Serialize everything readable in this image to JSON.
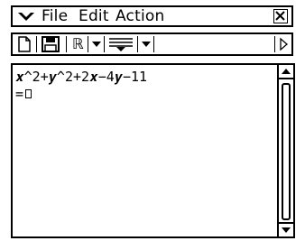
{
  "menubar": {
    "menu_icon": "chevron-down-icon",
    "items": [
      {
        "label": "File"
      },
      {
        "label": "Edit"
      },
      {
        "label": "Action"
      }
    ],
    "close_icon": "close-icon"
  },
  "toolbar": {
    "buttons": [
      {
        "icon": "new-file-icon"
      },
      {
        "icon": "save-icon"
      },
      {
        "label": "ℝ"
      },
      {
        "icon": "dropdown-arrow-icon"
      },
      {
        "icon": "filter-icon"
      },
      {
        "icon": "dropdown-arrow-icon"
      },
      {
        "icon": "scroll-right-icon"
      }
    ]
  },
  "document": {
    "lines": [
      {
        "text": "𝒙^2+𝒚^2+2𝒙−4𝒚−11"
      },
      {
        "text": "="
      }
    ]
  }
}
